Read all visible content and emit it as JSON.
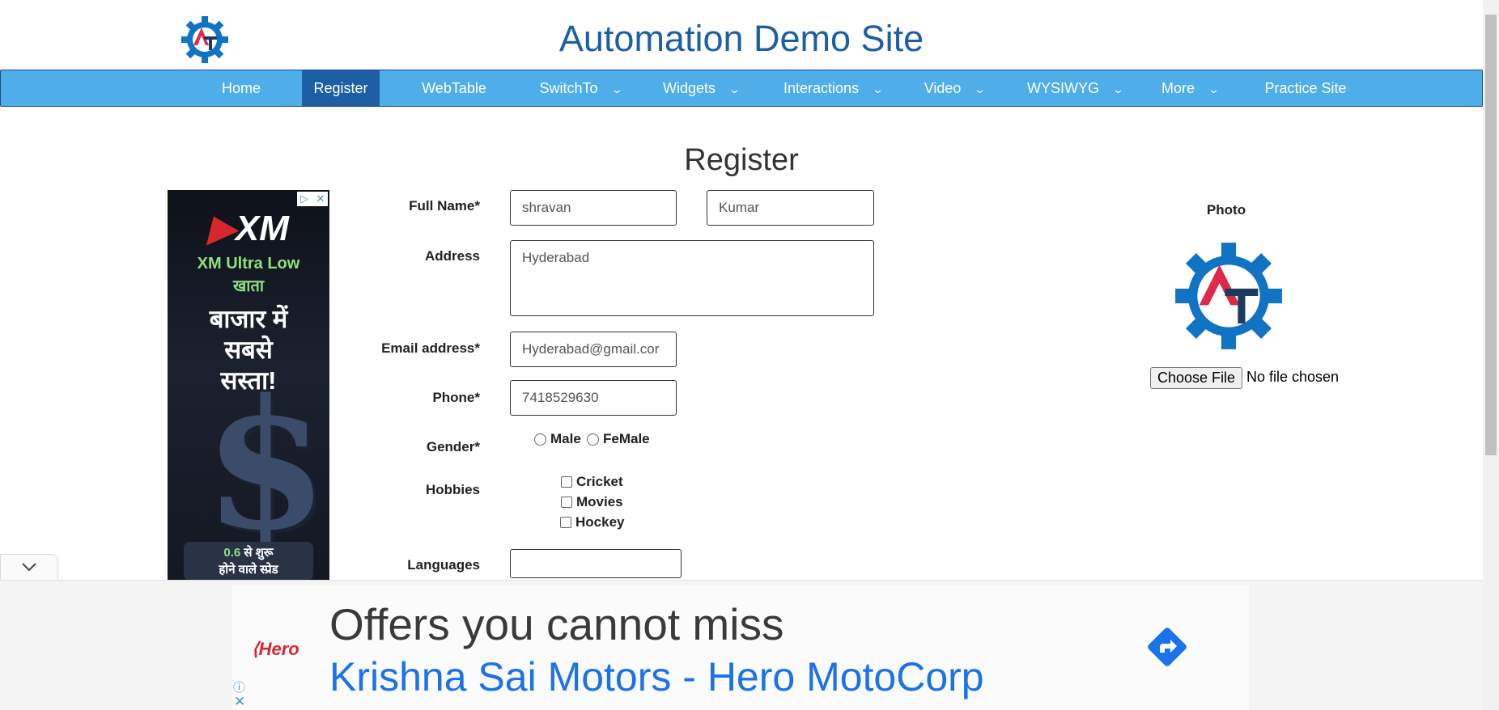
{
  "header": {
    "title": "Automation Demo Site",
    "logo_icon": "automation-testing-gear-logo"
  },
  "nav": {
    "items": [
      {
        "label": "Home",
        "dropdown": false,
        "active": false
      },
      {
        "label": "Register",
        "dropdown": false,
        "active": true
      },
      {
        "label": "WebTable",
        "dropdown": false,
        "active": false
      },
      {
        "label": "SwitchTo",
        "dropdown": true,
        "active": false
      },
      {
        "label": "Widgets",
        "dropdown": true,
        "active": false
      },
      {
        "label": "Interactions",
        "dropdown": true,
        "active": false
      },
      {
        "label": "Video",
        "dropdown": true,
        "active": false
      },
      {
        "label": "WYSIWYG",
        "dropdown": true,
        "active": false
      },
      {
        "label": "More",
        "dropdown": true,
        "active": false
      },
      {
        "label": "Practice Site",
        "dropdown": false,
        "active": false
      }
    ],
    "chevron": "⌄"
  },
  "page": {
    "title": "Register"
  },
  "form": {
    "full_name_label": "Full Name*",
    "first_name": "shravan",
    "last_name": "Kumar",
    "address_label": "Address",
    "address": "Hyderabad",
    "email_label": "Email address*",
    "email": "Hyderabad@gmail.cor",
    "phone_label": "Phone*",
    "phone": "7418529630",
    "gender_label": "Gender*",
    "gender_options": [
      "Male",
      "FeMale"
    ],
    "hobbies_label": "Hobbies",
    "hobbies": [
      "Cricket",
      "Movies",
      "Hockey"
    ],
    "languages_label": "Languages",
    "languages": ""
  },
  "photo": {
    "label": "Photo",
    "choose_file_label": "Choose File",
    "no_file_text": "No file chosen"
  },
  "side_ad": {
    "brand": "XM",
    "line1": "XM Ultra Low",
    "line2": "खाता",
    "line3": "बाजार में",
    "line4": "सबसे",
    "line5": "सस्ता!",
    "bottom1_value": "0.6",
    "bottom1_rest": " से शुरू",
    "bottom2": "होने वाले स्प्रेड"
  },
  "bottom_ad": {
    "brand": "Hero",
    "title": "Offers you cannot miss",
    "subtitle": "Krishna Sai Motors - Hero MotoCorp"
  },
  "colors": {
    "nav": "#4fadea",
    "nav_active": "#1d5fa5",
    "title": "#1d5fa5",
    "ad_link": "#1a73e8"
  }
}
